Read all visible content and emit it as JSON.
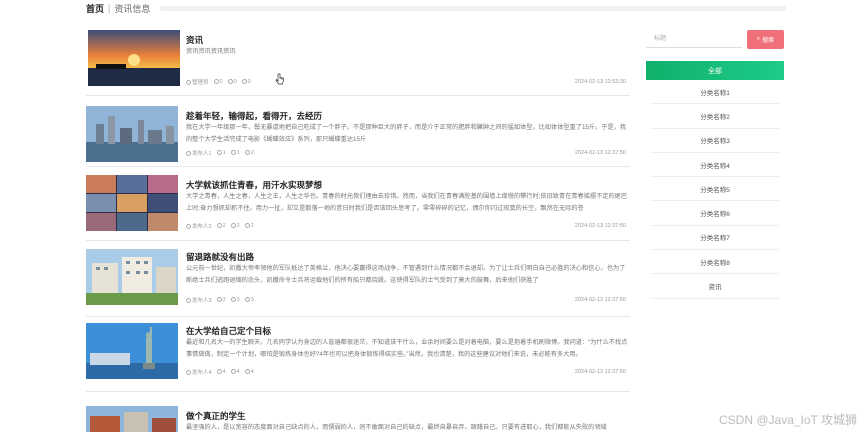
{
  "nav": {
    "home": "首页",
    "crumb": "资讯信息"
  },
  "articles": [
    {
      "title": "资讯",
      "desc": "资讯资讯资讯资讯",
      "author": "管理员",
      "likes": "0",
      "dislikes": "0",
      "comments": "0",
      "date": "2024-02-13 12:53:30"
    },
    {
      "title": "趁着年轻，输得起，看得开，去经历",
      "desc": "我在大学一年级那一年，鬃无暴虐地把自己吃成了一个胖子。不是那种巨大的胖子，而是介于正常的肥胖和臃肿之间的猛如体型。比如体体型重了15斤。于是，我的整个大学生活完成了电影《蝴蝶效应》系列，那只蝴蝶重达15斤",
      "author": "发布人1",
      "likes": "1",
      "dislikes": "1",
      "comments": "2",
      "date": "2024-02-13 12:37:50"
    },
    {
      "title": "大学就该抓住青春，用汗水实现梦想",
      "desc": "大学之青春，人生之春，人生之王，人生之华也。青春的时光我们理由去珍惜。然而，当我们在青春满腔基的围墙上缘慢的攀行时;依旧致青在青春摇摆不定的尾巴上时;奋力想抓却抓不住。用力一扯，却又是散落一地的昔日时我们是否该回头思考了。零零碎碎的记忆，偶尔你闪过寂寞的长空，飘然在无际的苍",
      "author": "发布人2",
      "likes": "2",
      "dislikes": "2",
      "comments": "2",
      "date": "2024-02-13 12:37:50"
    },
    {
      "title": "留退路就没有出路",
      "desc": "公元前一世纪，凯撒大帝率领他的军队抵达了英格兰，他决心要赢得这场战争，不管遇到什么情况都不会退却。为了让士兵们明白自己必胜的决心和信心，也为了断绝士兵们逃跑退缩的念头，凯撒命令士兵将运载他们的所有船只都烧毁。这使得军队的士气受到了莫大的鼓舞，后来他们获胜了",
      "author": "发布人3",
      "likes": "3",
      "dislikes": "3",
      "comments": "3",
      "date": "2024-02-13 12:37:50"
    },
    {
      "title": "在大学给自己定个目标",
      "desc": "最近和几名大一的学生聊天，几名同学认为身边的人普遍都很迷茫，不知道该干什么，业余时间要么是对着电脑，要么是抱着手机刷微博。我问道：“为什么不找点事情做做，制定一个计划，哪怕是锻炼身体也好?4年也可以把身体锻炼得结实些。”当然，我也清楚，我的这些建议对他们来说，未必能有多大用。",
      "author": "发布人4",
      "likes": "4",
      "dislikes": "4",
      "comments": "4",
      "date": "2024-02-13 12:37:50"
    },
    {
      "title": "做个真正的学生",
      "desc": "最坚强的人，是以宽容的态度面对自己缺点的人，而懦弱的人，则不敢面对自己的缺点，最终自暴自弃，踌躇自己。只要有进取心，我们都能从失败的领域",
      "author": "",
      "likes": "",
      "dislikes": "",
      "comments": "",
      "date": ""
    }
  ],
  "sidebar": {
    "search_placeholder": "标题",
    "search_button": "搜索",
    "all_label": "全部",
    "categories": [
      "分类名称1",
      "分类名称2",
      "分类名称3",
      "分类名称4",
      "分类名称5",
      "分类名称6",
      "分类名称7",
      "分类名称8",
      "资讯"
    ]
  },
  "watermark": "CSDN @Java_IoT 攻城狮",
  "colors": {
    "accent_green": "#0fb16a",
    "search_button": "#f0707a"
  }
}
